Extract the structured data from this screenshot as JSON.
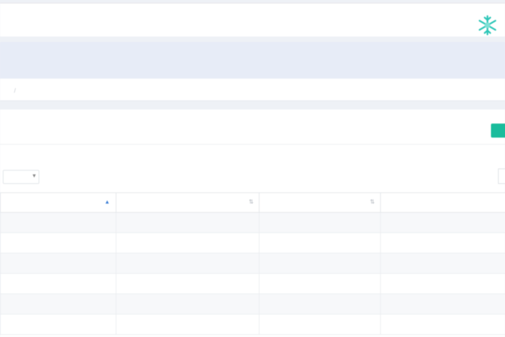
{
  "header": {
    "app_title": "",
    "logo_icon": "snowflake-logo-icon",
    "logo_color": "#2dc6b8"
  },
  "breadcrumb": {
    "previous": "",
    "current": ""
  },
  "panel": {
    "action_button_color": "#1abc9c",
    "length_select_value": "",
    "length_label": "",
    "search_label": "",
    "search_value": ""
  },
  "table": {
    "headers": [
      "",
      "",
      "",
      ""
    ],
    "rows": [
      [
        "",
        "",
        "",
        ""
      ],
      [
        "",
        "",
        "",
        ""
      ],
      [
        "",
        "",
        "",
        ""
      ],
      [
        "",
        "",
        "",
        ""
      ],
      [
        "",
        "",
        "",
        ""
      ],
      [
        "",
        "",
        "",
        ""
      ]
    ]
  }
}
